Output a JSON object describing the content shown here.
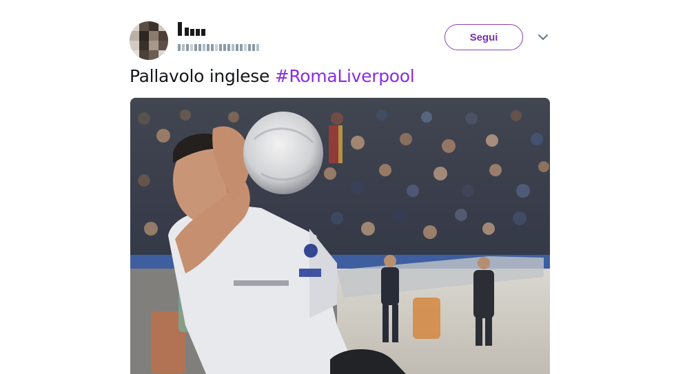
{
  "tweet": {
    "follow_label": "Segui",
    "text_plain": "Pallavolo inglese ",
    "hashtag": "#RomaLiverpool",
    "menu_icon": "chevron-down-icon"
  },
  "media": {
    "description_icon": "photo"
  },
  "colors": {
    "accent": "#8a2be2",
    "text": "#14171a"
  }
}
